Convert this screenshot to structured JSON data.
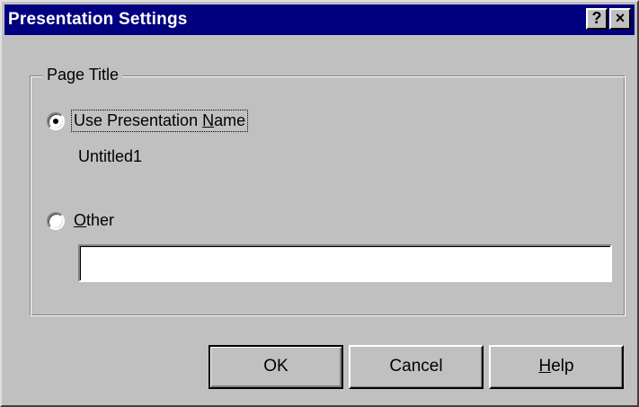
{
  "window": {
    "title": "Presentation Settings",
    "help_button": "?",
    "close_button": "×"
  },
  "group": {
    "label": "Page Title",
    "option_use": {
      "label_pre": "Use Presentation ",
      "label_accel": "N",
      "label_post": "ame",
      "selected": true
    },
    "presentation_name": "Untitled1",
    "option_other": {
      "label_accel": "O",
      "label_post": "ther",
      "selected": false
    },
    "other_value": ""
  },
  "buttons": {
    "ok": "OK",
    "cancel": "Cancel",
    "help_accel": "H",
    "help_post": "elp"
  },
  "colors": {
    "titlebar": "#000080",
    "face": "#c0c0c0"
  }
}
